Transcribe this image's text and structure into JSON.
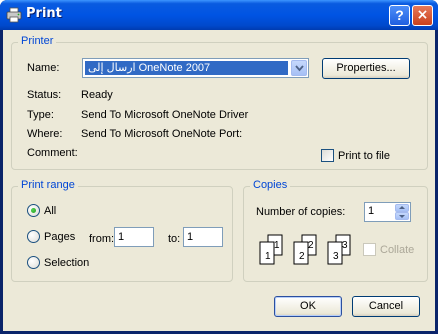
{
  "dialog": {
    "title": "Print",
    "help_button": "?",
    "close_button": "×"
  },
  "printer": {
    "group_title": "Printer",
    "name_label": "Name:",
    "name_value": "ارسال إلى OneNote 2007",
    "properties_button": "Properties...",
    "status_label": "Status:",
    "status_value": "Ready",
    "type_label": "Type:",
    "type_value": "Send To Microsoft OneNote Driver",
    "where_label": "Where:",
    "where_value": "Send To Microsoft OneNote Port:",
    "comment_label": "Comment:",
    "comment_value": "",
    "print_to_file_label": "Print to file",
    "print_to_file_checked": false
  },
  "print_range": {
    "group_title": "Print range",
    "all_label": "All",
    "pages_label": "Pages",
    "from_label": "from:",
    "from_value": "1",
    "to_label": "to:",
    "to_value": "1",
    "selection_label": "Selection",
    "selected": "All"
  },
  "copies": {
    "group_title": "Copies",
    "number_label": "Number of copies:",
    "number_value": "1",
    "collate_label": "Collate",
    "collate_enabled": false,
    "page_numbers": [
      "1",
      "1",
      "2",
      "2",
      "3",
      "3"
    ]
  },
  "footer": {
    "ok_button": "OK",
    "cancel_button": "Cancel"
  },
  "colors": {
    "titlebar": "#0054e3",
    "group_title": "#0046d5",
    "dialog_background": "#ece9d8",
    "selection_highlight": "#316ac5"
  }
}
